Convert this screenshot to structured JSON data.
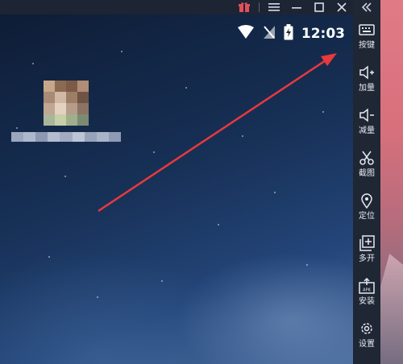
{
  "statusbar": {
    "time": "12:03"
  },
  "sidebar": {
    "collapse_icon": "double-chevron-left-icon",
    "items": [
      {
        "label": "按键",
        "icon": "keyboard-icon"
      },
      {
        "label": "加量",
        "icon": "volume-up-icon"
      },
      {
        "label": "减量",
        "icon": "volume-down-icon"
      },
      {
        "label": "截图",
        "icon": "scissors-icon"
      },
      {
        "label": "定位",
        "icon": "location-pin-icon"
      },
      {
        "label": "多开",
        "icon": "multi-instance-icon"
      },
      {
        "label": "安装",
        "icon": "apk-install-icon"
      },
      {
        "label": "设置",
        "icon": "gear-icon"
      }
    ]
  },
  "titlebar": {
    "gift_icon": "gift-icon",
    "menu_icon": "hamburger-menu-icon",
    "minimize_icon": "minimize-icon",
    "maximize_icon": "maximize-icon",
    "close_icon": "close-icon"
  },
  "colors": {
    "gift": "#e2505b",
    "annotation_arrow": "#e8393d",
    "sidebar_bg": "#1f2634",
    "titlebar_bg": "#1d2434"
  }
}
